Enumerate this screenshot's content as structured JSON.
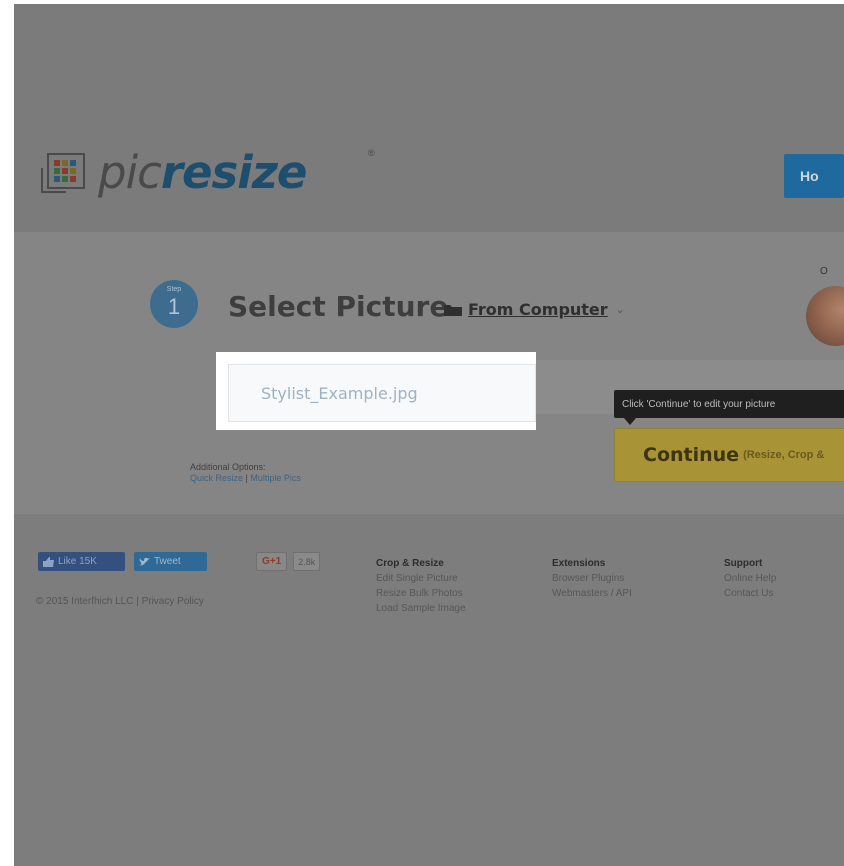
{
  "header": {
    "logo_pic": "pic",
    "logo_resize": "resize",
    "logo_reg": "®",
    "home_label": "Ho"
  },
  "step": {
    "badge_word": "Step",
    "badge_number": "1",
    "title": "Select Picture",
    "source_label": "From Computer",
    "source_chevron": "⌄",
    "or_label": "O"
  },
  "file_input": {
    "value": "Stylist_Example.jpg"
  },
  "tooltip": {
    "text": "Click 'Continue' to edit your picture"
  },
  "continue": {
    "label": "Continue",
    "sub_label": "(Resize, Crop &"
  },
  "additional": {
    "label": "Additional Options:",
    "quick_resize": "Quick Resize",
    "separator": "|",
    "multiple_pics": "Multiple Pics"
  },
  "social": {
    "like_label": "Like 15K",
    "tweet_label": "Tweet",
    "gplus_label": "G+1",
    "gplus_count": "2.8k"
  },
  "copyright": "© 2015 Interfhich LLC | Privacy Policy",
  "footer": {
    "crop_resize": {
      "heading": "Crop & Resize",
      "links": [
        "Edit Single Picture",
        "Resize Bulk Photos",
        "Load Sample Image"
      ]
    },
    "extensions": {
      "heading": "Extensions",
      "links": [
        "Browser Plugins",
        "Webmasters / API"
      ]
    },
    "support": {
      "heading": "Support",
      "links": [
        "Online Help",
        "Contact Us"
      ]
    }
  },
  "colors": {
    "overlay": "#7f7f7f",
    "brand_blue": "#1e6a9f",
    "continue_yellow": "#a89337",
    "highlight": "#ffffff"
  }
}
